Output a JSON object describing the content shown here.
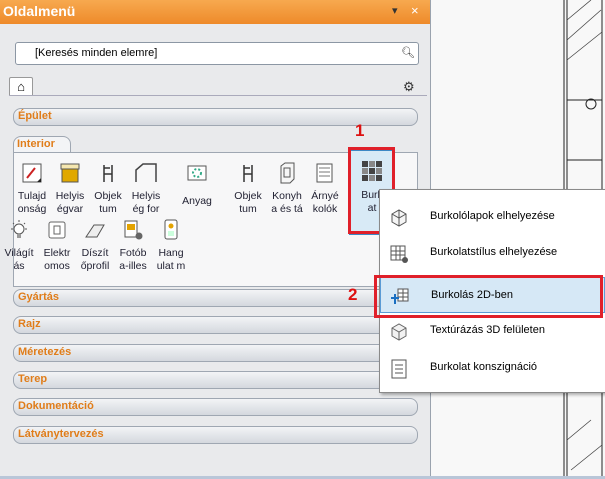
{
  "panel": {
    "title": "Oldalmenü",
    "pin_icon": "pin-icon",
    "close_label": "×",
    "search_placeholder": "[Keresés minden elemre]",
    "search_icon": "search-icon"
  },
  "categories_top": [
    {
      "label": "Épület"
    }
  ],
  "interior": {
    "label": "Interior",
    "row1": [
      {
        "label1": "Tulajd",
        "label2": "onság",
        "icon": "properties-icon"
      },
      {
        "label1": "Helyis",
        "label2": "égvar",
        "icon": "room-stamp-icon"
      },
      {
        "label1": "Objek",
        "label2": "tum",
        "icon": "chair-icon"
      },
      {
        "label1": "Helyis",
        "label2": "ég for",
        "icon": "room-shape-icon"
      },
      {
        "label1": "Anyag",
        "label2": "",
        "icon": "material-icon"
      },
      {
        "label1": "Objek",
        "label2": "tum",
        "icon": "chair-icon"
      },
      {
        "label1": "Konyh",
        "label2": "a és tá",
        "icon": "kitchen-icon"
      },
      {
        "label1": "Árnyé",
        "label2": "kolók",
        "icon": "shade-icon"
      },
      {
        "label1": "Burk",
        "label2": "at",
        "icon": "tiling-icon"
      }
    ],
    "row2": [
      {
        "label1": "Világít",
        "label2": "ás",
        "icon": "lamp-icon"
      },
      {
        "label1": "Elektr",
        "label2": "omos",
        "icon": "electric-icon"
      },
      {
        "label1": "Díszít",
        "label2": "őprofil",
        "icon": "molding-icon"
      },
      {
        "label1": "Fotób",
        "label2": "a-illes",
        "icon": "photo-fill-icon"
      },
      {
        "label1": "Hang",
        "label2": "ulat m",
        "icon": "mood-icon"
      }
    ]
  },
  "categories_bottom": [
    {
      "label": "Gyártás"
    },
    {
      "label": "Rajz"
    },
    {
      "label": "Méretezés"
    },
    {
      "label": "Terep"
    },
    {
      "label": "Dokumentáció"
    },
    {
      "label": "Látványtervezés"
    }
  ],
  "annotations": {
    "one": "1",
    "two": "2"
  },
  "menu": [
    {
      "label": "Burkolólapok elhelyezése",
      "icon": "tile-place-icon"
    },
    {
      "label": "Burkolatstílus elhelyezése",
      "icon": "tile-style-icon"
    },
    {
      "label": "Burkolás 2D-ben",
      "icon": "tile-2d-icon",
      "highlighted": true
    },
    {
      "label": "Textúrázás 3D felületen",
      "icon": "texture-3d-icon"
    },
    {
      "label": "Burkolat konszignáció",
      "icon": "consignation-icon"
    }
  ],
  "colors": {
    "accent": "#ee8a2a",
    "category_text": "#e07d1a",
    "highlight": "#d6e8f6",
    "annotation": "#e0202a"
  }
}
